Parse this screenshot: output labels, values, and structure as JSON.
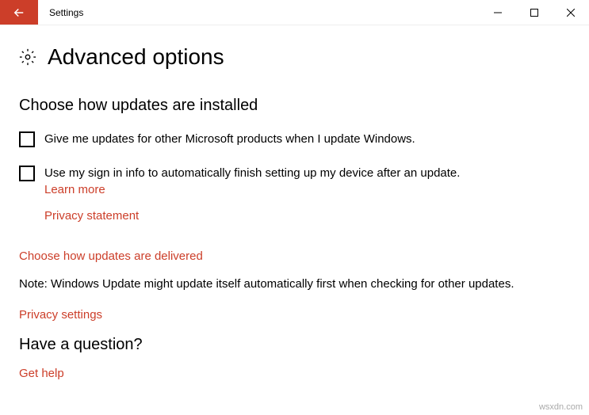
{
  "titlebar": {
    "app_name": "Settings"
  },
  "page": {
    "title": "Advanced options"
  },
  "section1": {
    "heading": "Choose how updates are installed",
    "checkbox1_label": "Give me updates for other Microsoft products when I update Windows.",
    "checkbox2_label": "Use my sign in info to automatically finish setting up my device after an update.",
    "learn_more": "Learn more",
    "privacy_statement": "Privacy statement",
    "delivery_link": "Choose how updates are delivered",
    "note": "Note: Windows Update might update itself automatically first when checking for other updates.",
    "privacy_settings": "Privacy settings"
  },
  "section2": {
    "heading": "Have a question?",
    "get_help": "Get help"
  },
  "watermark": "wsxdn.com"
}
